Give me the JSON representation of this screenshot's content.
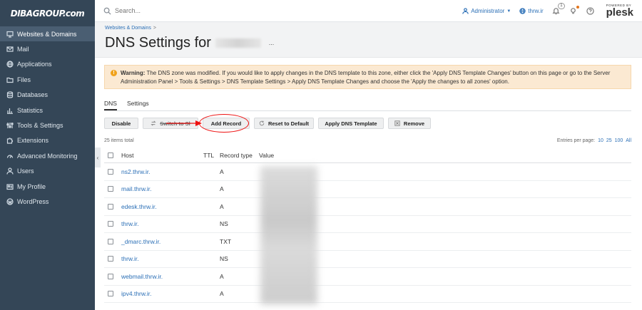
{
  "sidebar": {
    "logo": "DIBAGROUP.com",
    "items": [
      {
        "label": "Websites & Domains",
        "icon": "monitor-icon",
        "active": true
      },
      {
        "label": "Mail",
        "icon": "mail-icon"
      },
      {
        "label": "Applications",
        "icon": "globe-icon"
      },
      {
        "label": "Files",
        "icon": "folder-icon"
      },
      {
        "label": "Databases",
        "icon": "database-icon"
      },
      {
        "label": "Statistics",
        "icon": "bar-chart-icon"
      },
      {
        "label": "Tools & Settings",
        "icon": "sliders-icon"
      },
      {
        "label": "Extensions",
        "icon": "puzzle-icon"
      },
      {
        "label": "Advanced Monitoring",
        "icon": "gauge-icon"
      },
      {
        "label": "Users",
        "icon": "user-icon"
      },
      {
        "label": "My Profile",
        "icon": "id-card-icon"
      },
      {
        "label": "WordPress",
        "icon": "wordpress-icon"
      }
    ]
  },
  "header": {
    "search_placeholder": "Search...",
    "user": "Administrator",
    "subscription": "thrw.ir",
    "notification_count": "1",
    "powered_by": "POWERED BY",
    "brand": "plesk"
  },
  "breadcrumb": {
    "item": "Websites & Domains",
    "sep": ">"
  },
  "page": {
    "title": "DNS Settings for",
    "more": "..."
  },
  "warning": {
    "label": "Warning:",
    "text": "The DNS zone was modified. If you would like to apply changes in the DNS template to this zone, either click the 'Apply DNS Template Changes' button on this page or go to the Server Administration Panel > Tools & Settings > DNS Template Settings > Apply DNS Template Changes and choose the 'Apply the changes to all zones' option."
  },
  "tabs": [
    {
      "label": "DNS",
      "active": true
    },
    {
      "label": "Settings"
    }
  ],
  "toolbar": {
    "disable": "Disable",
    "switch": "Switch to Sl",
    "add": "Add Record",
    "reset": "Reset to Default",
    "apply": "Apply DNS Template",
    "remove": "Remove"
  },
  "list": {
    "items_total": "25 items total",
    "per_page_label": "Entries per page:",
    "per_page_options": [
      "10",
      "25",
      "100",
      "All"
    ]
  },
  "table": {
    "columns": {
      "host": "Host",
      "ttl": "TTL",
      "type": "Record type",
      "value": "Value"
    },
    "rows": [
      {
        "host": "ns2.thrw.ir.",
        "ttl": "",
        "type": "A"
      },
      {
        "host": "mail.thrw.ir.",
        "ttl": "",
        "type": "A"
      },
      {
        "host": "edesk.thrw.ir.",
        "ttl": "",
        "type": "A"
      },
      {
        "host": "thrw.ir.",
        "ttl": "",
        "type": "NS"
      },
      {
        "host": "_dmarc.thrw.ir.",
        "ttl": "",
        "type": "TXT"
      },
      {
        "host": "thrw.ir.",
        "ttl": "",
        "type": "NS"
      },
      {
        "host": "webmail.thrw.ir.",
        "ttl": "",
        "type": "A"
      },
      {
        "host": "ipv4.thrw.ir.",
        "ttl": "",
        "type": "A"
      }
    ]
  },
  "colors": {
    "sidebar": "#344657",
    "link": "#2b6fb6",
    "warning_bg": "#fbe9d2",
    "highlight": "#e11111"
  }
}
